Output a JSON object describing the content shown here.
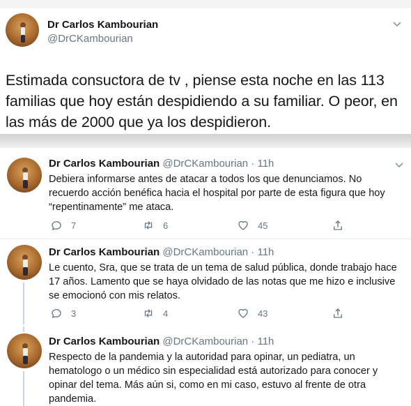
{
  "main_tweet": {
    "name": "Dr Carlos Kambourian",
    "handle": "@DrCKambourian",
    "text": "Estimada consuctora de tv , piense esta noche en las 113 familias que hoy están despidiendo a su familiar. O peor, en las más de 2000 que ya los despidieron."
  },
  "replies": [
    {
      "name": "Dr Carlos Kambourian",
      "handle_time": "@DrCKambourian · 11h",
      "text": "Debiera informarse antes de atacar a todos los que denunciamos. No recuerdo acción benéfica hacia el hospital por parte de esta figura que hoy “repentinamente” me ataca.",
      "replies": "7",
      "retweets": "6",
      "likes": "45"
    },
    {
      "name": "Dr Carlos Kambourian",
      "handle_time": "@DrCKambourian · 11h",
      "text": "Le cuento, Sra, que se trata de un tema de salud pública, donde trabajo hace 17 años. Lamento que se haya olvidado de las notas que me hizo e inclusive se emocionó con mis relatos.",
      "replies": "3",
      "retweets": "4",
      "likes": "43"
    },
    {
      "name": "Dr Carlos Kambourian",
      "handle_time": "@DrCKambourian · 11h",
      "text": "Respecto de la pandemia y  la autoridad para opinar, un pediatra, un hematologo o un médico sin especialidad está autorizado para conocer y opinar del tema. Más aún si, como en mi caso, estuvo al frente de otra pandemia."
    }
  ],
  "icons": {
    "reply": "reply-icon",
    "retweet": "retweet-icon",
    "like": "heart-icon",
    "share": "share-icon",
    "more": "chevron-down-icon"
  },
  "colors": {
    "text": "#14171a",
    "secondary": "#657786",
    "divider": "#e6ecf0",
    "thread_line": "#ccd6dd"
  }
}
